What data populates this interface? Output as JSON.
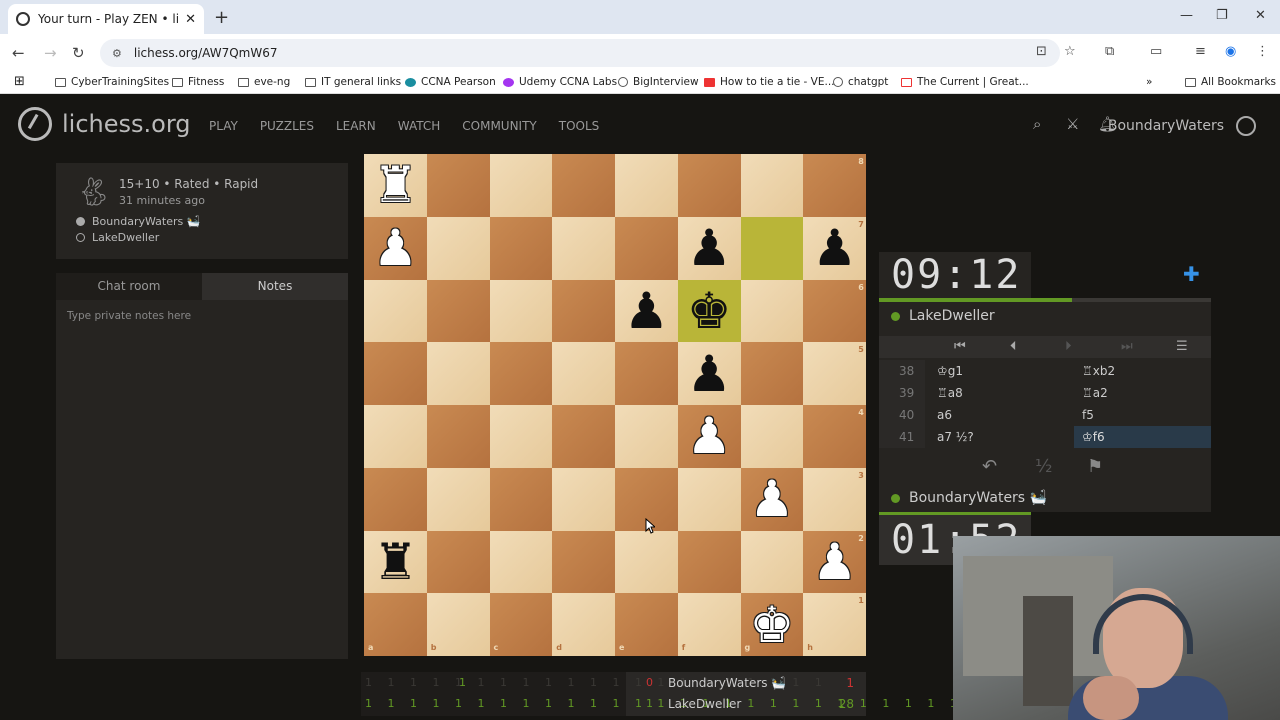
{
  "browser": {
    "tab_title": "Your turn - Play ZEN • lichess.org",
    "url": "lichess.org/AW7QmW67",
    "bookmarks": [
      {
        "label": "CyberTrainingSites",
        "icon": "folder-icon"
      },
      {
        "label": "Fitness",
        "icon": "folder-icon"
      },
      {
        "label": "eve-ng",
        "icon": "folder-icon"
      },
      {
        "label": "IT general links",
        "icon": "folder-icon"
      },
      {
        "label": "CCNA Pearson",
        "icon": "site-icon"
      },
      {
        "label": "Udemy CCNA Labs",
        "icon": "udemy-icon"
      },
      {
        "label": "BigInterview",
        "icon": "site-icon"
      },
      {
        "label": "How to tie a tie - VE...",
        "icon": "youtube-icon"
      },
      {
        "label": "chatgpt",
        "icon": "openai-icon"
      },
      {
        "label": "The Current | Great...",
        "icon": "site-icon"
      }
    ],
    "all_bookmarks": "All Bookmarks"
  },
  "header": {
    "site_name": "lichess.org",
    "nav": [
      "PLAY",
      "PUZZLES",
      "LEARN",
      "WATCH",
      "COMMUNITY",
      "TOOLS"
    ],
    "username": "BoundaryWaters"
  },
  "game_info": {
    "line1": "15+10 • Rated • Rapid",
    "line2": "31 minutes ago",
    "white_player": "BoundaryWaters 🛀",
    "black_player": "LakeDweller"
  },
  "chat": {
    "tab_chat": "Chat room",
    "tab_notes": "Notes",
    "notes_placeholder": "Type private notes here"
  },
  "board": {
    "files": [
      "a",
      "b",
      "c",
      "d",
      "e",
      "f",
      "g",
      "h"
    ],
    "ranks": [
      "8",
      "7",
      "6",
      "5",
      "4",
      "3",
      "2",
      "1"
    ],
    "highlight_squares": [
      "g7",
      "f6"
    ],
    "pieces": [
      {
        "sq": "a8",
        "color": "w",
        "glyph": "♜",
        "name": "white-rook"
      },
      {
        "sq": "a7",
        "color": "w",
        "glyph": "♟",
        "name": "white-pawn"
      },
      {
        "sq": "f7",
        "color": "b",
        "glyph": "♟",
        "name": "black-pawn"
      },
      {
        "sq": "h7",
        "color": "b",
        "glyph": "♟",
        "name": "black-pawn"
      },
      {
        "sq": "e6",
        "color": "b",
        "glyph": "♟",
        "name": "black-pawn"
      },
      {
        "sq": "f6",
        "color": "b",
        "glyph": "♚",
        "name": "black-king"
      },
      {
        "sq": "f5",
        "color": "b",
        "glyph": "♟",
        "name": "black-pawn"
      },
      {
        "sq": "f4",
        "color": "w",
        "glyph": "♟",
        "name": "white-pawn"
      },
      {
        "sq": "g3",
        "color": "w",
        "glyph": "♟",
        "name": "white-pawn"
      },
      {
        "sq": "a2",
        "color": "b",
        "glyph": "♜",
        "name": "black-rook"
      },
      {
        "sq": "h2",
        "color": "w",
        "glyph": "♟",
        "name": "white-pawn"
      },
      {
        "sq": "g1",
        "color": "w",
        "glyph": "♚",
        "name": "white-king"
      }
    ]
  },
  "clocks": {
    "top": "09:12",
    "top_progress": 0.58,
    "bottom": "01:52",
    "top_player": "LakeDweller",
    "bottom_player": "BoundaryWaters 🛀"
  },
  "moves": [
    {
      "num": "38",
      "white": "♔g1",
      "black": "♖xb2",
      "current": false
    },
    {
      "num": "39",
      "white": "♖a8",
      "black": "♖a2",
      "current": false
    },
    {
      "num": "40",
      "white": "a6",
      "black": "f5",
      "current": false
    },
    {
      "num": "41",
      "white": "a7 ½?",
      "black": "♔f6",
      "current": true
    }
  ],
  "actions": {
    "takeback": "↶",
    "draw": "½",
    "resign": "⚑"
  },
  "crosstable": {
    "row1_cells": "1",
    "row2_cells": "1 1 1 1 1 1 1 1 1 1 1 1 1 1 1 1 1 1 1 1 1 1 1 1 1 1 1",
    "p1_box": "0",
    "p1_name": "BoundaryWaters 🛀",
    "p1_score": "1",
    "p2_box": "1",
    "p2_name": "LakeDweller",
    "p2_score": "28"
  },
  "colors": {
    "accent_green": "#629924",
    "accent_blue": "#3692e7",
    "highlight": "#b9b538"
  }
}
